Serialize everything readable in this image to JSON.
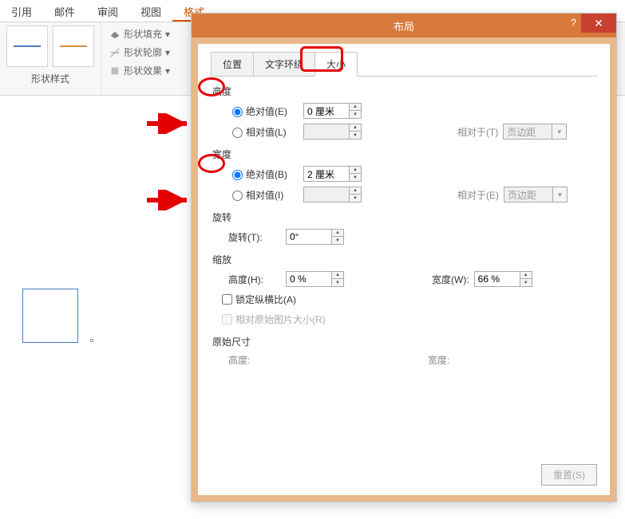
{
  "ribbon": {
    "tabs": {
      "reference": "引用",
      "mail": "邮件",
      "review": "审阅",
      "view": "视图",
      "format": "格式"
    },
    "shape_style_label": "形状样式",
    "shape_fill": "形状填充",
    "shape_outline": "形状轮廓",
    "shape_effects": "形状效果"
  },
  "dialog": {
    "title": "布局",
    "tabs": {
      "position": "位置",
      "text_wrap": "文字环绕",
      "size": "大小"
    },
    "height": {
      "title": "高度",
      "absolute_label": "绝对值(E)",
      "absolute_value": "0 厘米",
      "relative_label": "相对值(L)",
      "relative_value": "",
      "relative_to_label": "相对于(T)",
      "relative_to": "页边距"
    },
    "width": {
      "title": "宽度",
      "absolute_label": "绝对值(B)",
      "absolute_value": "2 厘米",
      "relative_label": "相对值(I)",
      "relative_value": "",
      "relative_to_label": "相对于(E)",
      "relative_to": "页边距"
    },
    "rotation": {
      "title": "旋转",
      "label": "旋转(T):",
      "value": "0°"
    },
    "scale": {
      "title": "缩放",
      "height_label": "高度(H):",
      "height_value": "0 %",
      "width_label": "宽度(W):",
      "width_value": "66 %",
      "lock_aspect_label": "锁定纵横比(A)",
      "relative_original_label": "相对原始图片大小(R)"
    },
    "original": {
      "title": "原始尺寸",
      "height_label": "高度:",
      "width_label": "宽度:"
    },
    "reset_btn": "重置(S)"
  }
}
